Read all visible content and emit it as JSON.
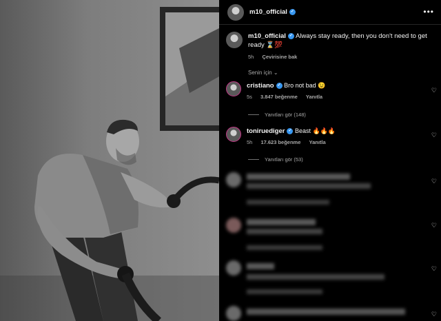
{
  "post": {
    "username": "m10_official",
    "more_icon": "more-horizontal-icon"
  },
  "caption": {
    "username": "m10_official",
    "text": "Always stay ready, then you don't need to get ready ⌛💯",
    "time": "5h",
    "translate": "Çevirisine bak"
  },
  "filter": {
    "label": "Senin için",
    "icon": "chevron-down-icon"
  },
  "comments": [
    {
      "username": "cristiano",
      "text": "Bro not bad 😉",
      "time": "5s",
      "likes": "3.847 beğenme",
      "reply": "Yanıtla",
      "view_replies": "Yanıtları gör (148)"
    },
    {
      "username": "toniruediger",
      "text": "Beast 🔥🔥🔥",
      "time": "5h",
      "likes": "17.623 beğenme",
      "reply": "Yanıtla",
      "view_replies": "Yanıtları gör (53)"
    }
  ],
  "colors": {
    "background": "#000000",
    "text": "#f5f5f5",
    "muted": "#a8a8a8",
    "verified": "#3897f0",
    "divider": "#262626"
  }
}
